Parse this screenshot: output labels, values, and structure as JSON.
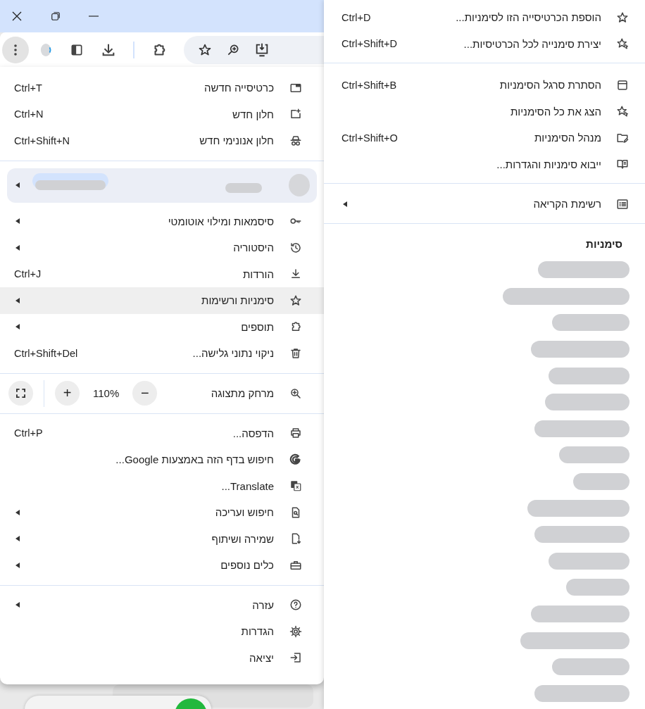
{
  "main_menu": {
    "sections": [
      {
        "items": [
          {
            "kind": "item",
            "label": "כרטיסייה חדשה",
            "shortcut": "Ctrl+T",
            "submenu": false,
            "highlighted": false
          },
          {
            "kind": "item",
            "label": "חלון חדש",
            "shortcut": "Ctrl+N",
            "submenu": false,
            "highlighted": false
          },
          {
            "kind": "item",
            "label": "חלון אנונימי חדש",
            "shortcut": "Ctrl+Shift+N",
            "submenu": false,
            "highlighted": false
          }
        ]
      },
      {
        "items": [
          {
            "kind": "profile",
            "submenu": true,
            "highlighted": false
          },
          {
            "kind": "item",
            "label": "סיסמאות ומילוי אוטומטי",
            "submenu": true,
            "highlighted": false
          },
          {
            "kind": "item",
            "label": "היסטוריה",
            "submenu": true,
            "highlighted": false
          },
          {
            "kind": "item",
            "label": "הורדות",
            "shortcut": "Ctrl+J",
            "submenu": false,
            "highlighted": false
          },
          {
            "kind": "item",
            "label": "סימניות ורשימות",
            "submenu": true,
            "highlighted": true
          },
          {
            "kind": "item",
            "label": "תוספים",
            "submenu": true,
            "highlighted": false
          },
          {
            "kind": "item",
            "label": "ניקוי נתוני גלישה...",
            "shortcut": "Ctrl+Shift+Del",
            "submenu": false,
            "highlighted": false
          }
        ]
      },
      {
        "items": [
          {
            "kind": "zoom",
            "label": "מרחק מתצוגה",
            "decrease": "−",
            "value": "110%",
            "increase": "+"
          }
        ]
      },
      {
        "items": [
          {
            "kind": "item",
            "label": "הדפסה...",
            "shortcut": "Ctrl+P",
            "submenu": false,
            "highlighted": false
          },
          {
            "kind": "item",
            "label": "חיפוש בדף הזה באמצעות Google...",
            "submenu": false,
            "highlighted": false
          },
          {
            "kind": "item",
            "label": "Translate...",
            "submenu": false,
            "highlighted": false
          },
          {
            "kind": "item",
            "label": "חיפוש ועריכה",
            "submenu": true,
            "highlighted": false
          },
          {
            "kind": "item",
            "label": "שמירה ושיתוף",
            "submenu": true,
            "highlighted": false
          },
          {
            "kind": "item",
            "label": "כלים נוספים",
            "submenu": true,
            "highlighted": false
          }
        ]
      },
      {
        "items": [
          {
            "kind": "item",
            "label": "עזרה",
            "submenu": true,
            "highlighted": false
          },
          {
            "kind": "item",
            "label": "הגדרות",
            "submenu": false,
            "highlighted": false
          },
          {
            "kind": "item",
            "label": "יציאה",
            "submenu": false,
            "highlighted": false
          }
        ]
      }
    ]
  },
  "bookmarks_menu": {
    "sections": [
      {
        "items": [
          {
            "label": "הוספת הכרטיסייה הזו לסימניות...",
            "shortcut": "Ctrl+D",
            "submenu": false
          },
          {
            "label": "יצירת סימנייה לכל הכרטיסיות...",
            "shortcut": "Ctrl+Shift+D",
            "submenu": false
          }
        ]
      },
      {
        "items": [
          {
            "label": "הסתרת סרגל הסימניות",
            "shortcut": "Ctrl+Shift+B",
            "submenu": false
          },
          {
            "label": "הצג את כל הסימניות",
            "submenu": false
          },
          {
            "label": "מנהל הסימניות",
            "shortcut": "Ctrl+Shift+O",
            "submenu": false
          },
          {
            "label": "ייבוא סימניות והגדרות...",
            "submenu": false
          }
        ]
      },
      {
        "items": [
          {
            "label": "רשימת הקריאה",
            "submenu": true
          }
        ]
      }
    ],
    "bookmarks_title": "סימניות",
    "bookmarks": [
      {
        "kind": "redacted"
      },
      {
        "kind": "redacted"
      },
      {
        "kind": "redacted"
      },
      {
        "kind": "redacted"
      },
      {
        "kind": "redacted"
      },
      {
        "kind": "redacted"
      },
      {
        "kind": "redacted"
      },
      {
        "kind": "redacted"
      },
      {
        "kind": "redacted"
      },
      {
        "kind": "redacted"
      },
      {
        "kind": "redacted"
      },
      {
        "kind": "redacted"
      },
      {
        "kind": "redacted"
      },
      {
        "kind": "redacted"
      },
      {
        "kind": "redacted"
      },
      {
        "kind": "redacted"
      },
      {
        "kind": "redacted"
      }
    ]
  }
}
